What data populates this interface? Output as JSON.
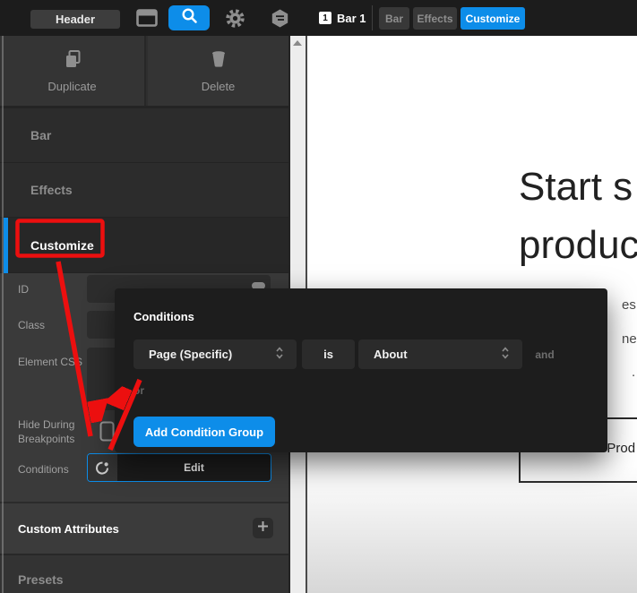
{
  "topbar": {
    "header_button": "Header",
    "element_badge": "1",
    "element_label": "Bar 1",
    "tabs": [
      {
        "label": "Bar"
      },
      {
        "label": "Effects"
      },
      {
        "label": "Customize"
      }
    ]
  },
  "inspector": {
    "duplicate_label": "Duplicate",
    "delete_label": "Delete",
    "sections": [
      {
        "label": "Bar"
      },
      {
        "label": "Effects"
      },
      {
        "label": "Customize"
      }
    ],
    "fields": {
      "id": "ID",
      "class": "Class",
      "element_css": "Element CSS",
      "hide_during_breakpoints": "Hide During Breakpoints",
      "conditions": "Conditions"
    },
    "edit_button": "Edit",
    "custom_attributes_label": "Custom Attributes",
    "presets_label": "Presets"
  },
  "conditions_popup": {
    "title": "Conditions",
    "type_select": "Page (Specific)",
    "operator": "is",
    "value_select": "About",
    "and_label": "and",
    "or_label": "or",
    "add_group_button": "Add Condition Group"
  },
  "preview": {
    "heading_line1": "Start s",
    "heading_line2": "produc",
    "paragraph_fragment1": "es ar",
    "paragraph_fragment2": "ne p",
    "paragraph_fragment3": ".",
    "product_button": "View Prod"
  },
  "colors": {
    "accent_blue": "#0d8de9",
    "annotation_red": "#ec0f0f"
  }
}
